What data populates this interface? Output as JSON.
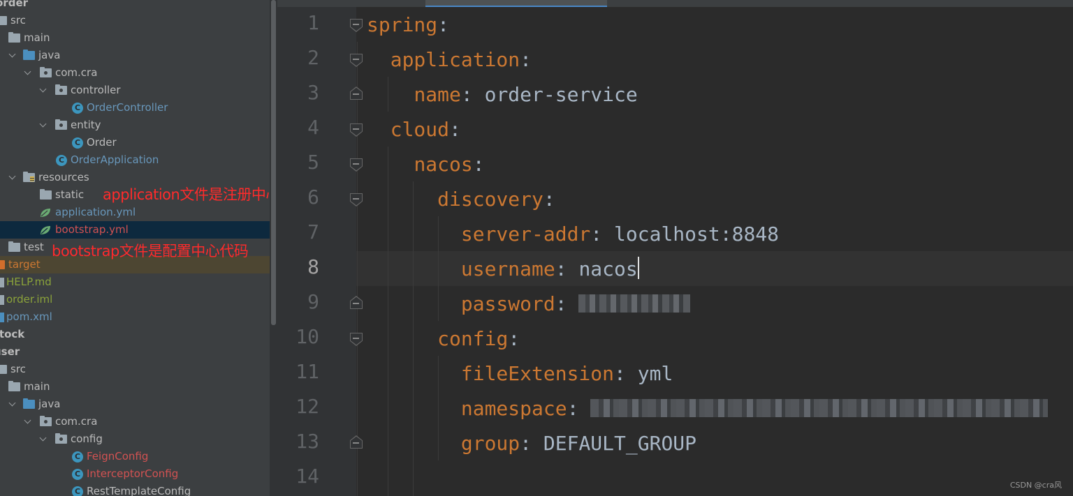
{
  "project_tree": {
    "rows": [
      {
        "label": "order",
        "style": "bold"
      },
      {
        "label": "src"
      },
      {
        "label": "main"
      },
      {
        "label": "java"
      },
      {
        "label": "com.cra"
      },
      {
        "label": "controller"
      },
      {
        "label": "OrderController",
        "style": "blue"
      },
      {
        "label": "entity"
      },
      {
        "label": "Order"
      },
      {
        "label": "OrderApplication",
        "style": "blue"
      },
      {
        "label": "resources"
      },
      {
        "label": "static"
      },
      {
        "label": "application.yml",
        "style": "blue"
      },
      {
        "label": "bootstrap.yml",
        "style": "red",
        "selected": true
      },
      {
        "label": "test"
      },
      {
        "label": "target",
        "style": "orange"
      },
      {
        "label": "HELP.md",
        "style": "green"
      },
      {
        "label": "order.iml",
        "style": "green"
      },
      {
        "label": "pom.xml",
        "style": "blue"
      },
      {
        "label": "stock",
        "style": "bold"
      },
      {
        "label": "user",
        "style": "bold"
      },
      {
        "label": "src"
      },
      {
        "label": "main"
      },
      {
        "label": "java"
      },
      {
        "label": "com.cra"
      },
      {
        "label": "config"
      },
      {
        "label": "FeignConfig",
        "style": "red"
      },
      {
        "label": "InterceptorConfig",
        "style": "red"
      },
      {
        "label": "RestTemplateConfig"
      }
    ],
    "annotation_application": "application文件是注册中心的文件",
    "annotation_bootstrap": "bootstrap文件是配置中心代码"
  },
  "editor": {
    "current_line": 8,
    "lines": [
      {
        "n": "1",
        "key": "spring",
        "sep": ":",
        "value": ""
      },
      {
        "n": "2",
        "key": "application",
        "sep": ":",
        "value": ""
      },
      {
        "n": "3",
        "key": "name",
        "sep": ": ",
        "value": "order-service"
      },
      {
        "n": "4",
        "key": "cloud",
        "sep": ":",
        "value": ""
      },
      {
        "n": "5",
        "key": "nacos",
        "sep": ":",
        "value": ""
      },
      {
        "n": "6",
        "key": "discovery",
        "sep": ":",
        "value": ""
      },
      {
        "n": "7",
        "key": "server-addr",
        "sep": ": ",
        "value": "localhost:8848"
      },
      {
        "n": "8",
        "key": "username",
        "sep": ": ",
        "value": "nacos"
      },
      {
        "n": "9",
        "key": "password",
        "sep": ": ",
        "value": ""
      },
      {
        "n": "10",
        "key": "config",
        "sep": ":",
        "value": ""
      },
      {
        "n": "11",
        "key": "fileExtension",
        "sep": ": ",
        "value": "yml"
      },
      {
        "n": "12",
        "key": "namespace",
        "sep": ": ",
        "value": ""
      },
      {
        "n": "13",
        "key": "group",
        "sep": ": ",
        "value": "DEFAULT_GROUP"
      },
      {
        "n": "14",
        "key": "",
        "sep": "",
        "value": ""
      }
    ]
  },
  "watermark": "CSDN @cra风",
  "colors": {
    "yaml_key": "#cc7832",
    "yaml_value": "#a9b7c6",
    "annotation": "#ff2b2b",
    "selection": "#0d293e"
  }
}
